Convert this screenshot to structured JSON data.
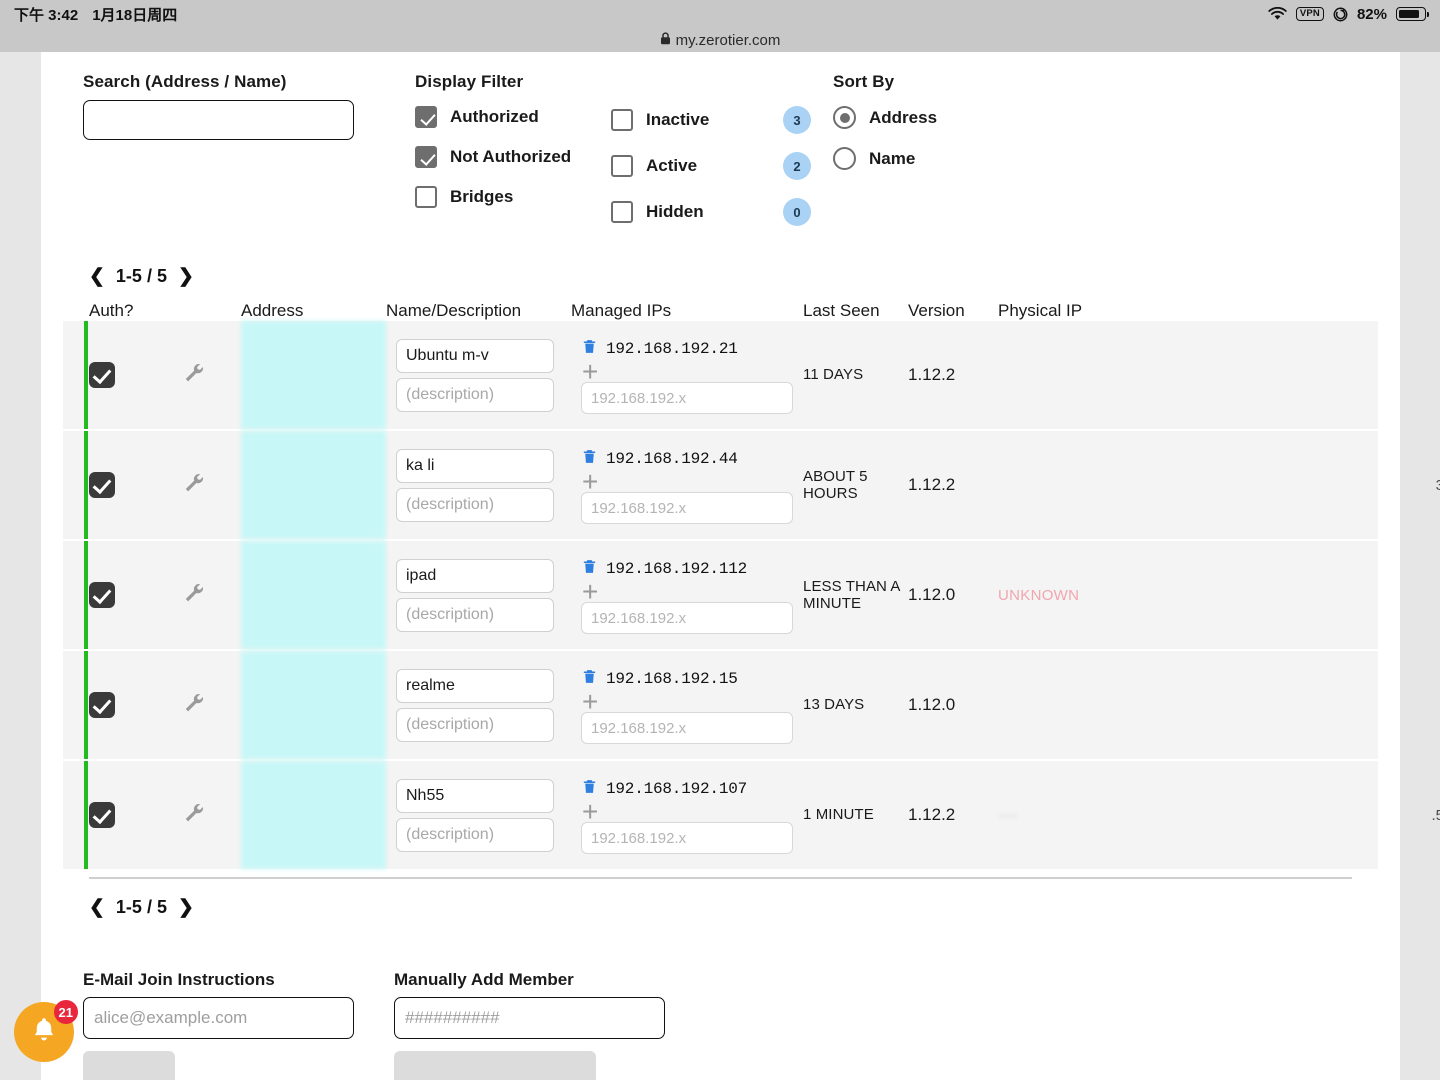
{
  "statusbar": {
    "time": "下午 3:42",
    "date": "1月18日周四",
    "wifi_icon": "wifi-icon",
    "vpn_label": "VPN",
    "rotation_icon": "rotation-lock-icon",
    "battery_percent": "82%",
    "battery_level": 82
  },
  "browser": {
    "lock_icon": "lock-icon",
    "url": "my.zerotier.com"
  },
  "search": {
    "label": "Search (Address / Name)",
    "value": "",
    "placeholder": ""
  },
  "display_filter": {
    "title": "Display Filter",
    "options": [
      {
        "label": "Authorized",
        "checked": true,
        "count": null
      },
      {
        "label": "Not Authorized",
        "checked": true,
        "count": null
      },
      {
        "label": "Bridges",
        "checked": false,
        "count": null
      },
      {
        "label": "Inactive",
        "checked": false,
        "count": "3"
      },
      {
        "label": "Active",
        "checked": false,
        "count": "2"
      },
      {
        "label": "Hidden",
        "checked": false,
        "count": "0"
      }
    ]
  },
  "sort_by": {
    "title": "Sort By",
    "options": [
      {
        "label": "Address",
        "selected": true
      },
      {
        "label": "Name",
        "selected": false
      }
    ]
  },
  "pagination": {
    "prev_icon": "chevron-left-icon",
    "next_icon": "chevron-right-icon",
    "range": "1-5 / 5"
  },
  "table": {
    "headers": {
      "auth": "Auth?",
      "address": "Address",
      "name": "Name/Description",
      "managed_ips": "Managed IPs",
      "last_seen": "Last Seen",
      "version": "Version",
      "physical_ip": "Physical IP"
    },
    "name_placeholder": "(description)",
    "ip_placeholder": "192.168.192.x",
    "rows": [
      {
        "authorized": true,
        "name": "Ubuntu m-v",
        "description": "",
        "managed_ip": "192.168.192.21",
        "last_seen": "11 DAYS",
        "version": "1.12.2",
        "physical_ip": "",
        "physical_ip_state": "blank"
      },
      {
        "authorized": true,
        "name": "ka li",
        "description": "",
        "managed_ip": "192.168.192.44",
        "last_seen": "ABOUT 5 HOURS",
        "version": "1.12.2",
        "physical_ip": "3",
        "physical_ip_state": "fragment"
      },
      {
        "authorized": true,
        "name": "ipad",
        "description": "",
        "managed_ip": "192.168.192.112",
        "last_seen": "LESS THAN A MINUTE",
        "version": "1.12.0",
        "physical_ip": "UNKNOWN",
        "physical_ip_state": "unknown"
      },
      {
        "authorized": true,
        "name": "realme",
        "description": "",
        "managed_ip": "192.168.192.15",
        "last_seen": "13 DAYS",
        "version": "1.12.0",
        "physical_ip": "",
        "physical_ip_state": "blank"
      },
      {
        "authorized": true,
        "name": "Nh55",
        "description": "",
        "managed_ip": "192.168.192.107",
        "last_seen": "1 MINUTE",
        "version": "1.12.2",
        "physical_ip": ".5",
        "physical_ip_state": "fragment"
      }
    ]
  },
  "bottom": {
    "email_join": {
      "label": "E-Mail Join Instructions",
      "value": "",
      "placeholder": "alice@example.com"
    },
    "manual_add": {
      "label": "Manually Add Member",
      "value": "",
      "placeholder": "##########"
    }
  },
  "fab": {
    "icon": "bell-icon",
    "badge": "21"
  }
}
